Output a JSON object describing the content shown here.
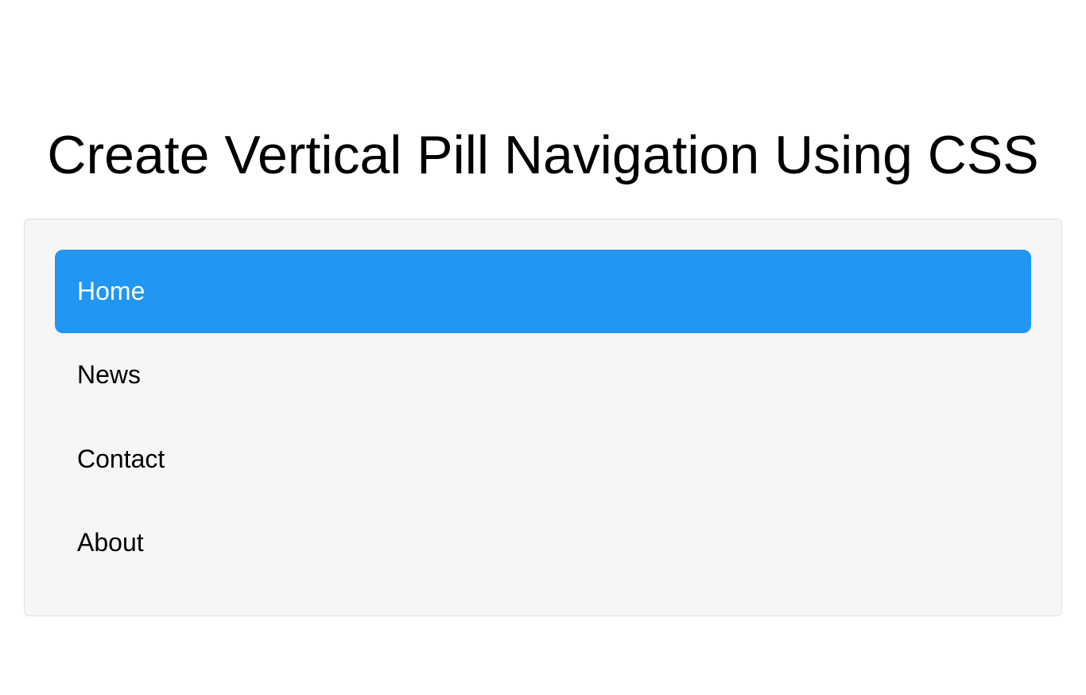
{
  "heading": "Create Vertical Pill Navigation Using CSS",
  "nav": {
    "items": [
      {
        "label": "Home",
        "active": true
      },
      {
        "label": "News",
        "active": false
      },
      {
        "label": "Contact",
        "active": false
      },
      {
        "label": "About",
        "active": false
      }
    ]
  },
  "colors": {
    "active_bg": "#2196f3",
    "active_text": "#ffffff",
    "container_bg": "#f6f6f6"
  }
}
